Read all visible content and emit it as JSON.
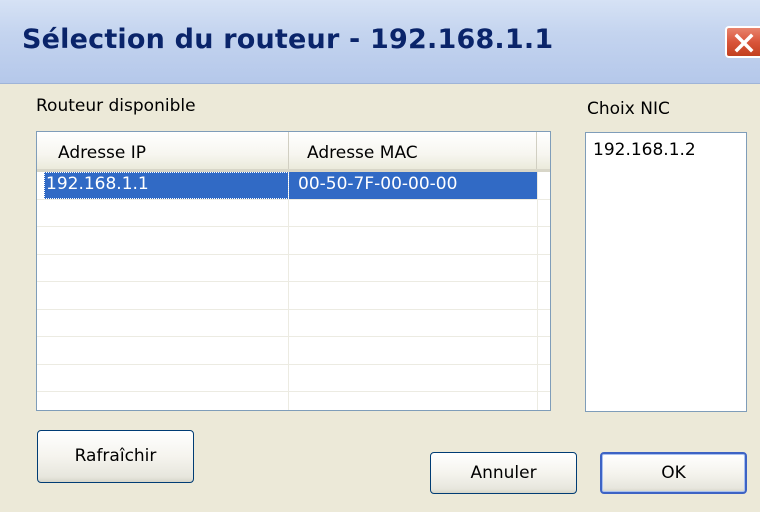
{
  "window": {
    "title": "Sélection du routeur - 192.168.1.1"
  },
  "routers": {
    "label": "Routeur disponible",
    "columns": [
      "Adresse IP",
      "Adresse MAC"
    ],
    "rows": [
      {
        "ip": "192.168.1.1",
        "mac": "00-50-7F-00-00-00",
        "selected": true
      }
    ],
    "empty_rows": 8
  },
  "nic": {
    "label": "Choix NIC",
    "items": [
      "192.168.1.2"
    ]
  },
  "buttons": {
    "refresh": "Rafraîchir",
    "cancel": "Annuler",
    "ok": "OK"
  },
  "colors": {
    "selection": "#316ac5",
    "title_text": "#0a246a",
    "close_button": "#d9553a",
    "dialog_bg": "#ece9d8"
  },
  "icons": {
    "close": "close-icon"
  }
}
